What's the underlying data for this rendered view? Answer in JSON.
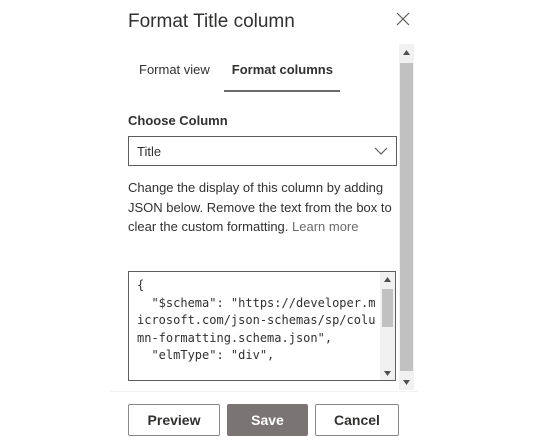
{
  "panel": {
    "title": "Format Title column",
    "close_icon": "close-icon"
  },
  "tabs": [
    {
      "label": "Format view",
      "selected": false
    },
    {
      "label": "Format columns",
      "selected": true
    }
  ],
  "choose_column": {
    "label": "Choose Column",
    "selected_value": "Title",
    "chevron_icon": "chevron-down-icon"
  },
  "description": {
    "text": "Change the display of this column by adding JSON below. Remove the text from the box to clear the custom formatting.",
    "link": "Learn more"
  },
  "json_editor": {
    "value": "{\n  \"$schema\": \"https://developer.microsoft.com/json-schemas/sp/column-formatting.schema.json\",\n  \"elmType\": \"div\","
  },
  "footer": {
    "preview_label": "Preview",
    "save_label": "Save",
    "cancel_label": "Cancel"
  },
  "colors": {
    "text": "#323130",
    "save_button_bg": "#7a7574",
    "border": "#605e5c",
    "scrollbar_track": "#f1f1f1",
    "scrollbar_thumb": "#c1c1c1"
  }
}
